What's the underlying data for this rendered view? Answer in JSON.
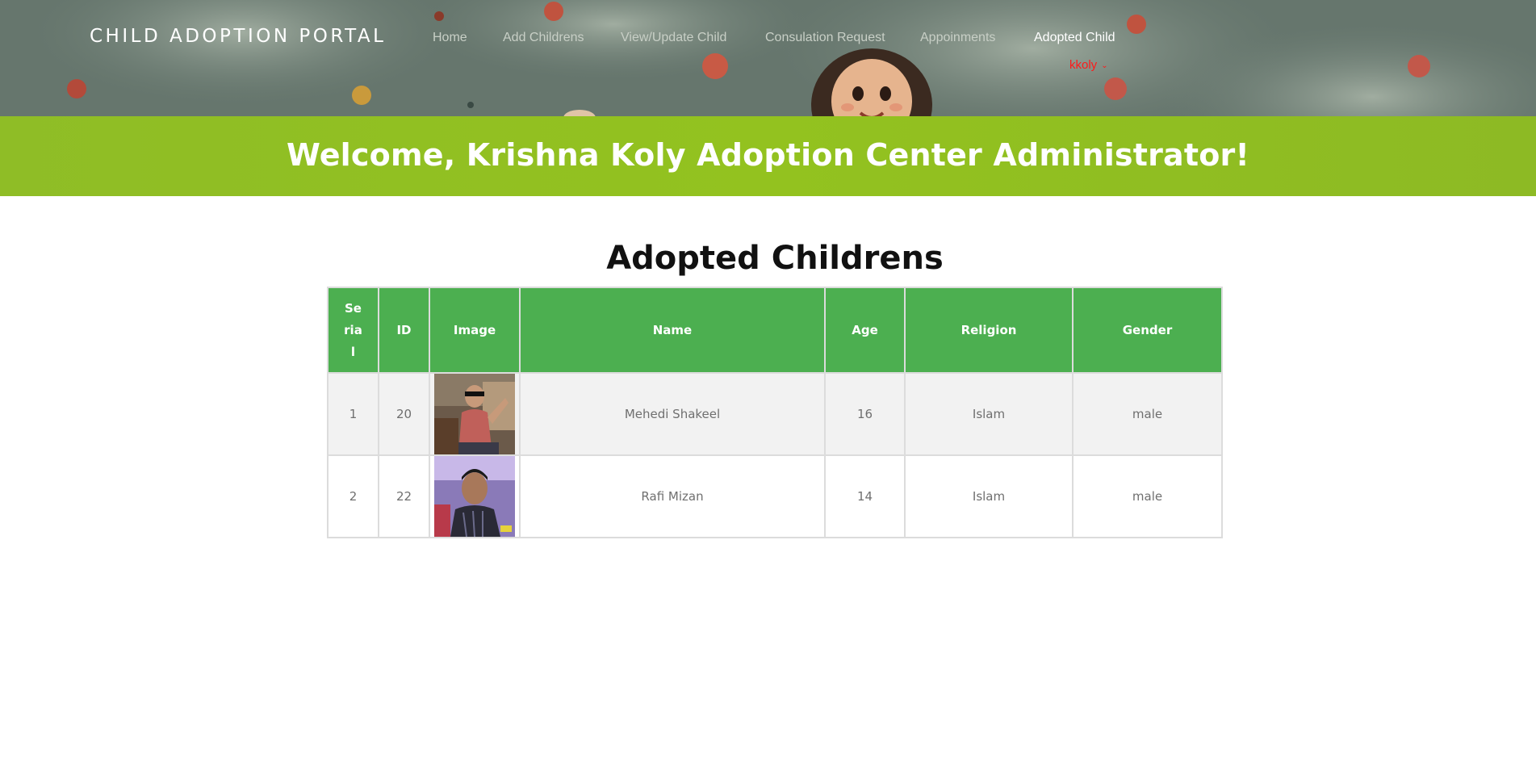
{
  "header": {
    "brand": "CHILD ADOPTION PORTAL",
    "nav": [
      {
        "label": "Home",
        "active": false
      },
      {
        "label": "Add Childrens",
        "active": false
      },
      {
        "label": "View/Update Child",
        "active": false
      },
      {
        "label": "Consulation Request",
        "active": false
      },
      {
        "label": "Appoinments",
        "active": false
      },
      {
        "label": "Adopted Child",
        "active": true
      }
    ],
    "user": {
      "name": "kkoly",
      "icon": "chevron-down-icon",
      "color": "#ff1a1a"
    }
  },
  "banner": {
    "welcome": "Welcome, Krishna Koly Adoption Center Administrator!",
    "color": "#93c21f"
  },
  "main": {
    "title": "Adopted Childrens",
    "table": {
      "header_color": "#4caf50",
      "columns": [
        "Serial",
        "ID",
        "Image",
        "Name",
        "Age",
        "Religion",
        "Gender"
      ],
      "rows": [
        {
          "serial": "1",
          "id": "20",
          "image": "child-photo-icon",
          "name": "Mehedi Shakeel",
          "age": "16",
          "religion": "Islam",
          "gender": "male"
        },
        {
          "serial": "2",
          "id": "22",
          "image": "child-photo-icon",
          "name": "Rafi Mizan",
          "age": "14",
          "religion": "Islam",
          "gender": "male"
        }
      ]
    }
  }
}
